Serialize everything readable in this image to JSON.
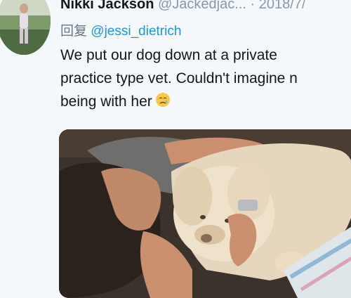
{
  "author": {
    "name": "Nikki Jackson",
    "handle": "@Jackedjac...",
    "separator": "·",
    "date": "2018/7/"
  },
  "reply": {
    "prefix": "回复",
    "to": "@jessi_dietrich"
  },
  "tweet": {
    "lines": [
      "We put our dog down at a private",
      "practice type vet. Couldn't imagine n",
      "being with her"
    ],
    "emoji": "crying-face-icon"
  },
  "colors": {
    "link": "#1b95e0",
    "muted": "#8899a6",
    "text": "#14171a",
    "background": "#f5f8fa"
  }
}
